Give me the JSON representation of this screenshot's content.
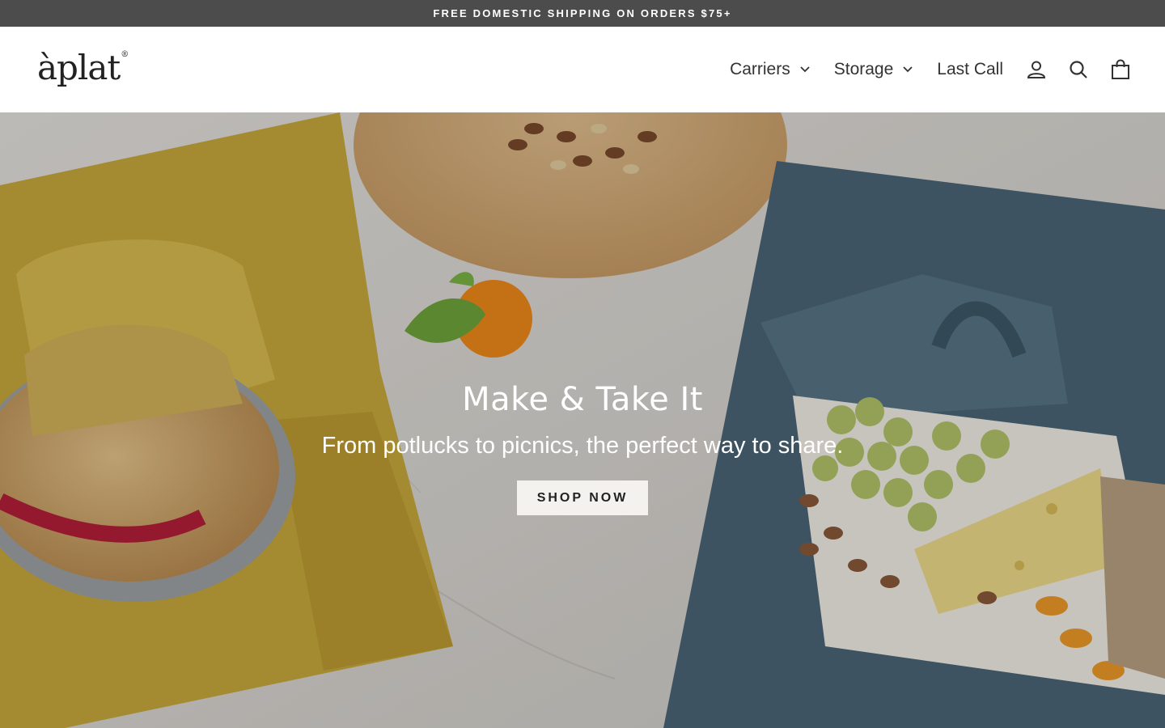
{
  "announcement": {
    "text": "FREE DOMESTIC SHIPPING ON ORDERS $75+"
  },
  "header": {
    "logo_text": "àplat",
    "logo_mark": "®",
    "nav": [
      {
        "label": "Carriers",
        "has_dropdown": true
      },
      {
        "label": "Storage",
        "has_dropdown": true
      },
      {
        "label": "Last Call",
        "has_dropdown": false
      }
    ],
    "icons": [
      "account-icon",
      "search-icon",
      "cart-icon"
    ]
  },
  "hero": {
    "title": "Make & Take It",
    "subtitle": "From potlucks to picnics, the perfect way to share.",
    "button_label": "SHOP NOW"
  },
  "colors": {
    "announcement_bg": "#4d4c4c",
    "mustard": "#c9a93c",
    "denim": "#4b6677",
    "marble": "#dcd9d4"
  }
}
